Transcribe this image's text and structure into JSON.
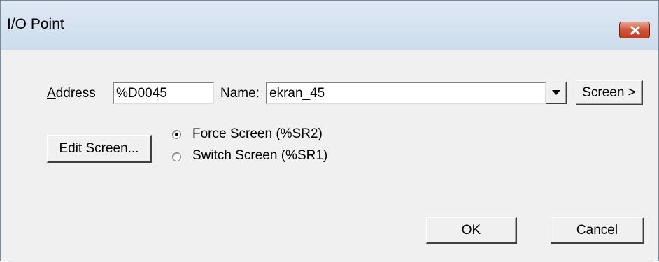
{
  "window": {
    "title": "I/O Point"
  },
  "address": {
    "label": "Address",
    "mnemonic": "A",
    "rest": "ddress",
    "value": "%D0045"
  },
  "name": {
    "label": "Name:",
    "value": "ekran_45"
  },
  "buttons": {
    "screen": "Screen >",
    "edit_screen": "Edit Screen...",
    "ok": "OK",
    "cancel": "Cancel"
  },
  "radios": [
    {
      "label": "Force Screen (%SR2)",
      "checked": true
    },
    {
      "label": "Switch Screen (%SR1)",
      "checked": false
    }
  ],
  "icons": {
    "close": "close-icon",
    "dropdown": "chevron-down-icon"
  },
  "colors": {
    "close_button": "#c8442a",
    "face": "#f0f0f0"
  }
}
